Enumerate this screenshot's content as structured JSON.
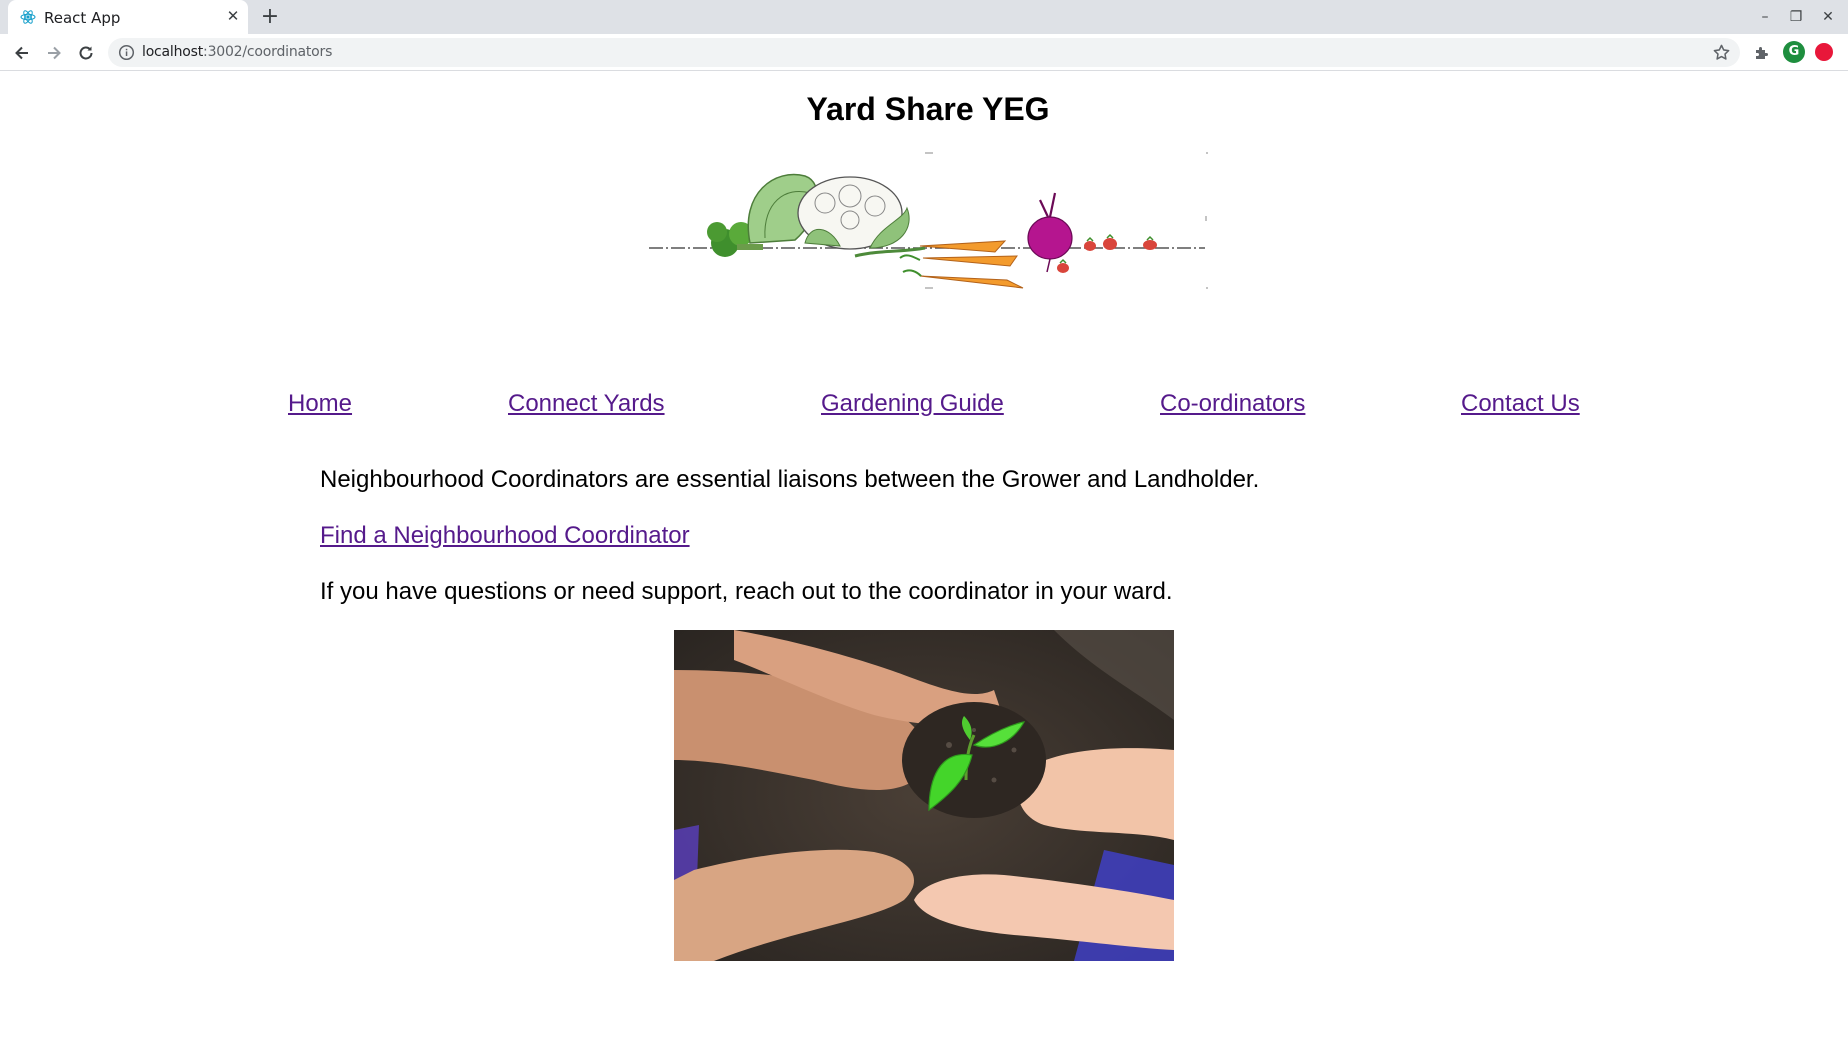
{
  "browser": {
    "tab_title": "React App",
    "tab_close": "✕",
    "new_tab": "+",
    "url_host": "localhost",
    "url_path": ":3002/coordinators",
    "profile_initial": "G",
    "window_controls": {
      "minimize": "–",
      "restore": "❐",
      "close": "✕"
    }
  },
  "site": {
    "title": "Yard Share YEG",
    "banner_alt": "vegetables-banner"
  },
  "nav": {
    "items": [
      {
        "label": "Home"
      },
      {
        "label": "Connect Yards"
      },
      {
        "label": "Gardening Guide"
      },
      {
        "label": "Co-ordinators"
      },
      {
        "label": "Contact Us"
      }
    ]
  },
  "content": {
    "intro": "Neighbourhood Coordinators are essential liaisons between the Grower and Landholder.",
    "find_link": "Find a Neighbourhood Coordinator",
    "support": "If you have questions or need support, reach out to the coordinator in your ward."
  },
  "colors": {
    "link": "#551a8b",
    "tabbar": "#dee1e6",
    "omnibox": "#f1f3f4"
  }
}
